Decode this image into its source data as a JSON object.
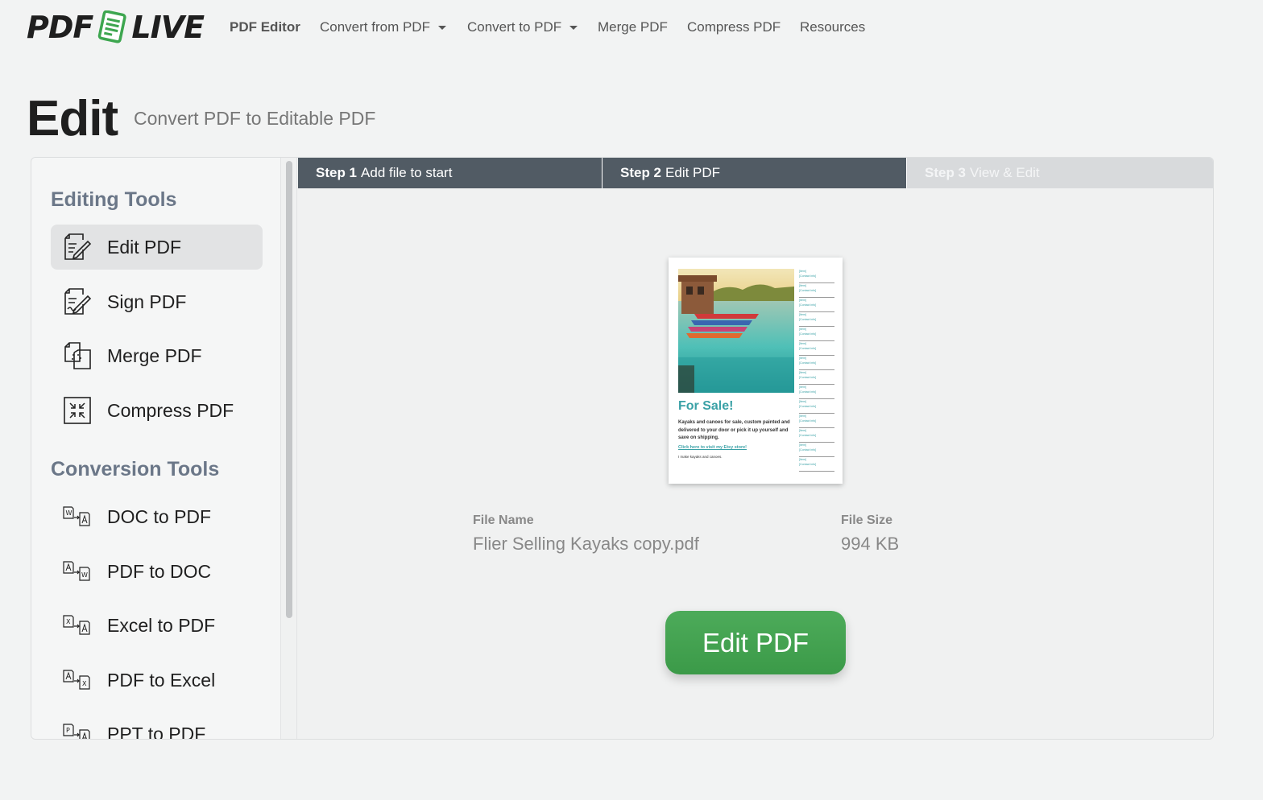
{
  "brand": {
    "logo_left": "PDF",
    "logo_right": "LIVE"
  },
  "nav": {
    "items": [
      {
        "label": "PDF Editor",
        "active": true,
        "dropdown": false
      },
      {
        "label": "Convert from PDF",
        "active": false,
        "dropdown": true
      },
      {
        "label": "Convert to PDF",
        "active": false,
        "dropdown": true
      },
      {
        "label": "Merge PDF",
        "active": false,
        "dropdown": false
      },
      {
        "label": "Compress PDF",
        "active": false,
        "dropdown": false
      },
      {
        "label": "Resources",
        "active": false,
        "dropdown": false
      }
    ]
  },
  "header": {
    "title": "Edit",
    "subtitle": "Convert PDF to Editable PDF"
  },
  "sidebar": {
    "editing_title": "Editing Tools",
    "editing_tools": [
      {
        "label": "Edit PDF",
        "icon": "edit-pdf-icon",
        "active": true
      },
      {
        "label": "Sign PDF",
        "icon": "sign-pdf-icon",
        "active": false
      },
      {
        "label": "Merge PDF",
        "icon": "merge-pdf-icon",
        "active": false
      },
      {
        "label": "Compress PDF",
        "icon": "compress-pdf-icon",
        "active": false
      }
    ],
    "conversion_title": "Conversion Tools",
    "conversion_tools": [
      {
        "label": "DOC to PDF",
        "icon": "doc-to-pdf-icon",
        "from": "W",
        "to": "pdf"
      },
      {
        "label": "PDF to DOC",
        "icon": "pdf-to-doc-icon",
        "from": "pdf",
        "to": "W"
      },
      {
        "label": "Excel to PDF",
        "icon": "excel-to-pdf-icon",
        "from": "X",
        "to": "pdf"
      },
      {
        "label": "PDF to Excel",
        "icon": "pdf-to-excel-icon",
        "from": "pdf",
        "to": "X"
      },
      {
        "label": "PPT to PDF",
        "icon": "ppt-to-pdf-icon",
        "from": "P",
        "to": "pdf"
      }
    ]
  },
  "steps": [
    {
      "num": "Step 1",
      "label": "Add file to start",
      "state": "done"
    },
    {
      "num": "Step 2",
      "label": "Edit PDF",
      "state": "current"
    },
    {
      "num": "Step 3",
      "label": "View & Edit",
      "state": "pending"
    }
  ],
  "thumbnail": {
    "title": "For Sale!",
    "body": "Kayaks and canoes for sale, custom painted and delivered to your door or pick it up yourself and save on shipping.",
    "link": "Click here to visit my Etsy store!",
    "small": "I make kayaks and canoes.",
    "list_item": "[Item]",
    "list_contact": "[Contact info]"
  },
  "file": {
    "name_label": "File Name",
    "name_value": "Flier Selling Kayaks copy.pdf",
    "size_label": "File Size",
    "size_value": "994 KB"
  },
  "action": {
    "button_label": "Edit PDF"
  },
  "colors": {
    "accent_green": "#43a350",
    "step_active": "#515b64",
    "step_pending": "#d8dadc",
    "section_title": "#6b7788"
  }
}
